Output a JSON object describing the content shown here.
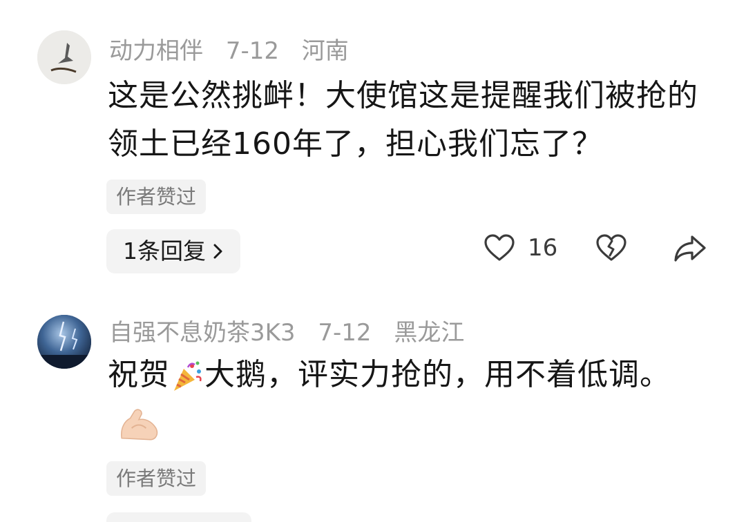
{
  "comments": [
    {
      "username": "动力相伴",
      "date": "7-12",
      "location": "河南",
      "text": "这是公然挑衅！大使馆这是提醒我们被抢的领土已经160年了，担心我们忘了？",
      "author_liked": "作者赞过",
      "replies_label": "1条回复",
      "like_count": "16",
      "icons": {
        "like": "heart-outline-icon",
        "dislike": "broken-heart-icon",
        "share": "share-arrow-icon"
      }
    },
    {
      "username": "自强不息奶茶3K3",
      "date": "7-12",
      "location": "黑龙江",
      "text_part1": "祝贺",
      "emoji1": "party-popper-icon",
      "text_part2": "大鹅，评实力抢的，用不着低调。",
      "emoji2": "flexed-biceps-icon",
      "author_liked": "作者赞过"
    }
  ]
}
